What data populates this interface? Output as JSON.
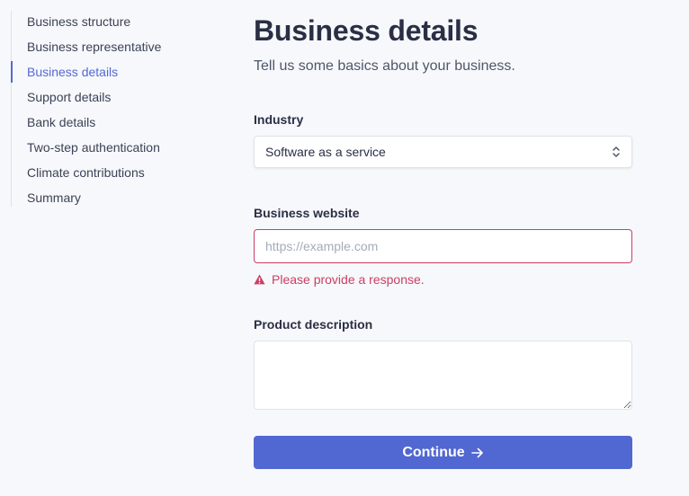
{
  "sidebar": {
    "items": [
      {
        "label": "Business structure",
        "active": false
      },
      {
        "label": "Business representative",
        "active": false
      },
      {
        "label": "Business details",
        "active": true
      },
      {
        "label": "Support details",
        "active": false
      },
      {
        "label": "Bank details",
        "active": false
      },
      {
        "label": "Two-step authentication",
        "active": false
      },
      {
        "label": "Climate contributions",
        "active": false
      },
      {
        "label": "Summary",
        "active": false
      }
    ]
  },
  "main": {
    "title": "Business details",
    "subtitle": "Tell us some basics about your business.",
    "industry": {
      "label": "Industry",
      "value": "Software as a service",
      "icon": "chevron-up-down-icon"
    },
    "website": {
      "label": "Business website",
      "placeholder": "https://example.com",
      "value": "",
      "error": "Please provide a response.",
      "error_icon": "warning-triangle-icon"
    },
    "product": {
      "label": "Product description",
      "value": ""
    },
    "continue": {
      "label": "Continue",
      "icon": "arrow-right-icon"
    }
  },
  "colors": {
    "accent": "#5469d4",
    "error": "#cd3d64",
    "button": "#5167d2",
    "background": "#f6f8fb"
  }
}
